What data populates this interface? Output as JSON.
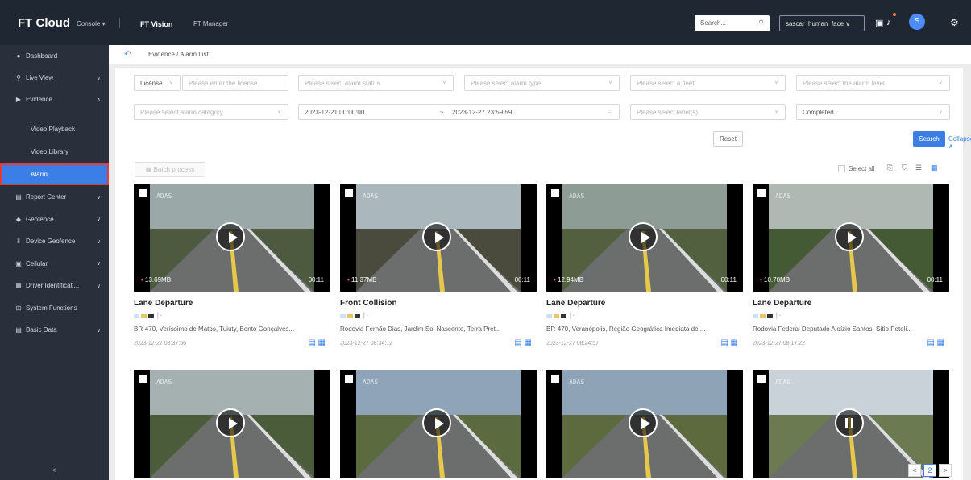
{
  "topbar": {
    "logo": "FT Cloud",
    "console": "Console ▾",
    "nav": [
      "FT Vision",
      "FT Manager"
    ],
    "search_placeholder": "Search...",
    "tenant": "sascar_human_face ∨",
    "avatar": "S"
  },
  "sidebar": {
    "items": [
      {
        "icon": "●",
        "label": "Dashboard",
        "arrow": ""
      },
      {
        "icon": "⚲",
        "label": "Live View",
        "arrow": "∨"
      },
      {
        "icon": "▶",
        "label": "Evidence",
        "arrow": "∧"
      },
      {
        "icon": "",
        "label": "Video Playback",
        "arrow": ""
      },
      {
        "icon": "",
        "label": "Video Library",
        "arrow": ""
      },
      {
        "icon": "",
        "label": "Alarm",
        "arrow": ""
      },
      {
        "icon": "▤",
        "label": "Report Center",
        "arrow": "∨"
      },
      {
        "icon": "◆",
        "label": "Geofence",
        "arrow": "∨"
      },
      {
        "icon": "⦀",
        "label": "Device Geofence",
        "arrow": "∨"
      },
      {
        "icon": "▣",
        "label": "Cellular",
        "arrow": "∨"
      },
      {
        "icon": "▦",
        "label": "Driver Identificati...",
        "arrow": "∨"
      },
      {
        "icon": "⊞",
        "label": "System Functions",
        "arrow": ""
      },
      {
        "icon": "▤",
        "label": "Basic Data",
        "arrow": "∨"
      }
    ],
    "collapse": "<"
  },
  "breadcrumb": {
    "text": "Evidence / Alarm List"
  },
  "filters": {
    "license_select": "License...",
    "license_placeholder": "Please enter the license ...",
    "alarm_status": "Please select alarm status",
    "alarm_type": "Please select alarm type",
    "fleet": "Please select a fleet",
    "alarm_level": "Please select the alarm level",
    "alarm_category": "Please select alarm category",
    "date_start": "2023-12-21 00:00:00",
    "date_sep": "~",
    "date_end": "2023-12-27 23:59:59",
    "labels": "Please select label(s)",
    "completed": "Completed"
  },
  "actions": {
    "reset": "Reset",
    "search": "Search",
    "collapse": "Collapse ∧",
    "batch": "Batch process",
    "select_all": "Select all"
  },
  "cards": [
    {
      "title": "Lane Departure",
      "size": "13.69MB",
      "duration": "00:11",
      "address": "BR-470, Veríssimo de Matos, Tuiuty, Bento Gonçalves...",
      "time": "2023-12-27 08:37:56",
      "osd": "ADAS",
      "sky": "#9aa9a8",
      "ground": "#4d5a3f"
    },
    {
      "title": "Front Collision",
      "size": "11.37MB",
      "duration": "00:11",
      "address": "Rodovia Fernão Dias, Jardim Sol Nascente, Terra Pret...",
      "time": "2023-12-27 08:34:12",
      "osd": "ADAS",
      "sky": "#aab7bd",
      "ground": "#4a4b3d"
    },
    {
      "title": "Lane Departure",
      "size": "12.94MB",
      "duration": "00:11",
      "address": "BR-470, Veranópolis, Região Geográfica Imediata de ...",
      "time": "2023-12-27 08:24:57",
      "osd": "ADAS",
      "sky": "#8e9c96",
      "ground": "#52603f"
    },
    {
      "title": "Lane Departure",
      "size": "10.70MB",
      "duration": "00:11",
      "address": "Rodovia Federal Deputado Aloízio Santos, Sítio Peteli...",
      "time": "2023-12-27 08:17:22",
      "osd": "ADAS",
      "sky": "#b0b8b4",
      "ground": "#445a34"
    },
    {
      "title": "",
      "size": "",
      "duration": "",
      "address": "",
      "time": "",
      "osd": "ADAS",
      "sky": "#a5b1b0",
      "ground": "#4b5c3a"
    },
    {
      "title": "",
      "size": "",
      "duration": "",
      "address": "",
      "time": "",
      "osd": "ADAS",
      "sky": "#8fa4b8",
      "ground": "#5c6b3f"
    },
    {
      "title": "",
      "size": "",
      "duration": "",
      "address": "",
      "time": "",
      "osd": "ADAS",
      "sky": "#8ea3b5",
      "ground": "#5d6a3e"
    },
    {
      "title": "",
      "size": "",
      "duration": "",
      "address": "",
      "time": "",
      "osd": "ADAS",
      "sky": "#c9d2d8",
      "ground": "#6b7a50"
    }
  ],
  "pager": {
    "prev": "<",
    "page": "2",
    "next": ">"
  }
}
